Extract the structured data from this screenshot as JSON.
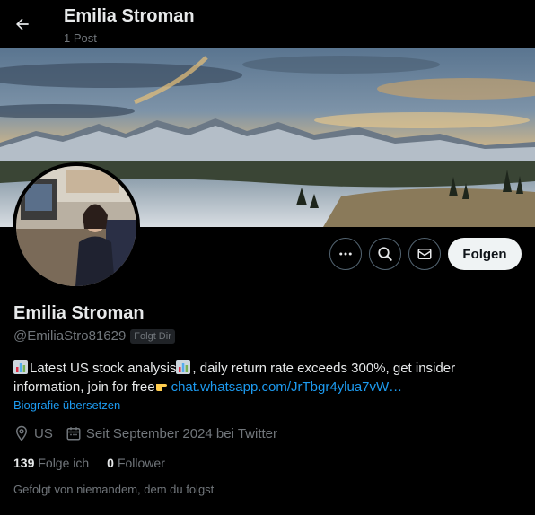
{
  "header": {
    "title": "Emilia Stroman",
    "post_count": "1 Post"
  },
  "actions": {
    "more_icon": "more-horizontal-icon",
    "search_icon": "search-icon",
    "message_icon": "mail-icon",
    "follow_label": "Folgen"
  },
  "profile": {
    "display_name": "Emilia Stroman",
    "handle": "@EmiliaStro81629",
    "follows_you_badge": "Folgt Dir",
    "bio_text_1": "Latest US stock analysis",
    "bio_text_2": ", daily return rate exceeds 300%, get insider information, join for free",
    "bio_link": "chat.whatsapp.com/JrTbgr4ylua7vW…",
    "translate_label": "Biografie übersetzen",
    "location": "US",
    "joined": "Seit September 2024 bei Twitter"
  },
  "stats": {
    "following_count": "139",
    "following_label": "Folge ich",
    "followers_count": "0",
    "followers_label": "Follower"
  },
  "followed_by_note": "Gefolgt von niemandem, dem du folgst",
  "colors": {
    "accent": "#1d9bf0",
    "background": "#000000",
    "text_primary": "#e7e9ea",
    "text_secondary": "#71767b",
    "button_light": "#eff3f4"
  }
}
